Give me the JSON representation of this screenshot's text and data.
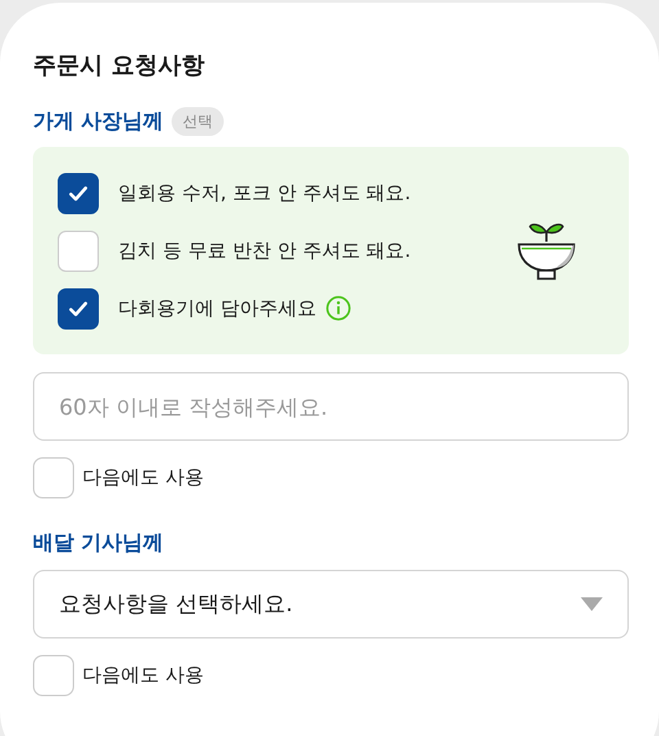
{
  "title": "주문시 요청사항",
  "store": {
    "label": "가게 사장님께",
    "badge": "선택",
    "options": [
      {
        "text": "일회용 수저, 포크 안 주셔도 돼요.",
        "checked": true,
        "info": false
      },
      {
        "text": "김치 등 무료 반찬 안 주셔도 돼요.",
        "checked": false,
        "info": false
      },
      {
        "text": "다회용기에 담아주세요",
        "checked": true,
        "info": true
      }
    ],
    "input": {
      "placeholder": "60자 이내로 작성해주세요."
    },
    "remember": {
      "label": "다음에도 사용",
      "checked": false
    }
  },
  "rider": {
    "label": "배달 기사님께",
    "select": {
      "value": "요청사항을 선택하세요."
    },
    "remember": {
      "label": "다음에도 사용",
      "checked": false
    }
  }
}
